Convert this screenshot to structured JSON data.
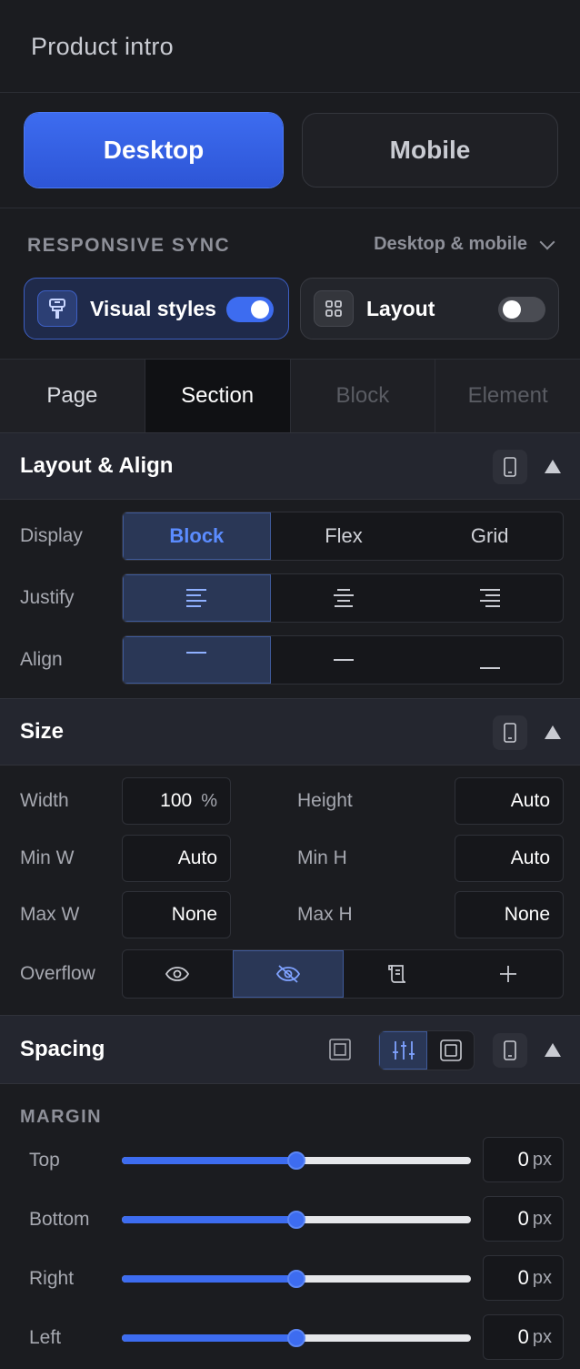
{
  "header": {
    "title": "Product intro"
  },
  "device": {
    "desktop": "Desktop",
    "mobile": "Mobile",
    "selected": "Desktop"
  },
  "sync": {
    "label": "RESPONSIVE SYNC",
    "dropdown": "Desktop & mobile",
    "visual_label": "Visual styles",
    "visual_on": true,
    "layout_label": "Layout",
    "layout_on": false
  },
  "tabs": [
    "Page",
    "Section",
    "Block",
    "Element"
  ],
  "layout_align": {
    "title": "Layout & Align",
    "display_label": "Display",
    "display_options": [
      "Block",
      "Flex",
      "Grid"
    ],
    "display_selected": "Block",
    "justify_label": "Justify",
    "align_label": "Align"
  },
  "size": {
    "title": "Size",
    "width_label": "Width",
    "width_value": "100",
    "width_unit": "%",
    "height_label": "Height",
    "height_value": "Auto",
    "minw_label": "Min W",
    "minw_value": "Auto",
    "minh_label": "Min H",
    "minh_value": "Auto",
    "maxw_label": "Max W",
    "maxw_value": "None",
    "maxh_label": "Max H",
    "maxh_value": "None",
    "overflow_label": "Overflow",
    "overflow_options": [
      "eye-icon",
      "eye-off-icon",
      "scroll-icon",
      "plus-icon"
    ],
    "overflow_selected": "eye-off-icon"
  },
  "spacing": {
    "title": "Spacing",
    "margin_label": "MARGIN",
    "rows": [
      {
        "label": "Top",
        "value": "0",
        "unit": "px",
        "slider": 0.5
      },
      {
        "label": "Bottom",
        "value": "0",
        "unit": "px",
        "slider": 0.5
      },
      {
        "label": "Right",
        "value": "0",
        "unit": "px",
        "slider": 0.5
      },
      {
        "label": "Left",
        "value": "0",
        "unit": "px",
        "slider": 0.5
      }
    ]
  },
  "colors": {
    "accent": "#3d6cf0",
    "background": "#1b1c20",
    "selected_text": "#5b8cff"
  }
}
